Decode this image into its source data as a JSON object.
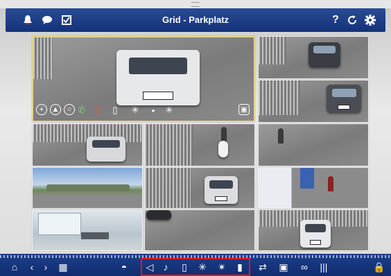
{
  "header": {
    "title": "Grid - Parkplatz",
    "help_label": "?",
    "left_icons": [
      "alarm-bell-icon",
      "chat-icon",
      "checkbox-icon"
    ],
    "right_icons": [
      "help-icon",
      "refresh-icon",
      "settings-gear-icon"
    ],
    "accent_color": "#1b3a82"
  },
  "grid": {
    "selected_cell": "parking-lot-main",
    "cells": [
      "parking-lot-main",
      "gate-car-right-1",
      "gate-car-right-2",
      "car-left",
      "scooter-rider",
      "cyclist",
      "panorama-view",
      "car-center",
      "pedestrian",
      "office-indoor",
      "car-bottom",
      "car-bottom-right"
    ],
    "overlay_icons": [
      "zoom-icon",
      "ptz-icon",
      "circle-icon",
      "phone-answer-icon",
      "phone-hangup-icon",
      "door-icon",
      "light-icon",
      "dot-icon",
      "light-small-icon",
      "snapshot-icon"
    ]
  },
  "toolbar": {
    "icons": [
      "home-icon",
      "back-icon",
      "forward-icon",
      "layout-icon",
      "camera-dome-icon",
      "speaker-icon",
      "microphone-icon",
      "door-icon",
      "light-icon",
      "light-dim-icon",
      "thermometer-icon",
      "swap-icon",
      "display-icon",
      "link-icon",
      "barcode-icon",
      "lock-icon"
    ],
    "highlight_color": "#e01818"
  }
}
